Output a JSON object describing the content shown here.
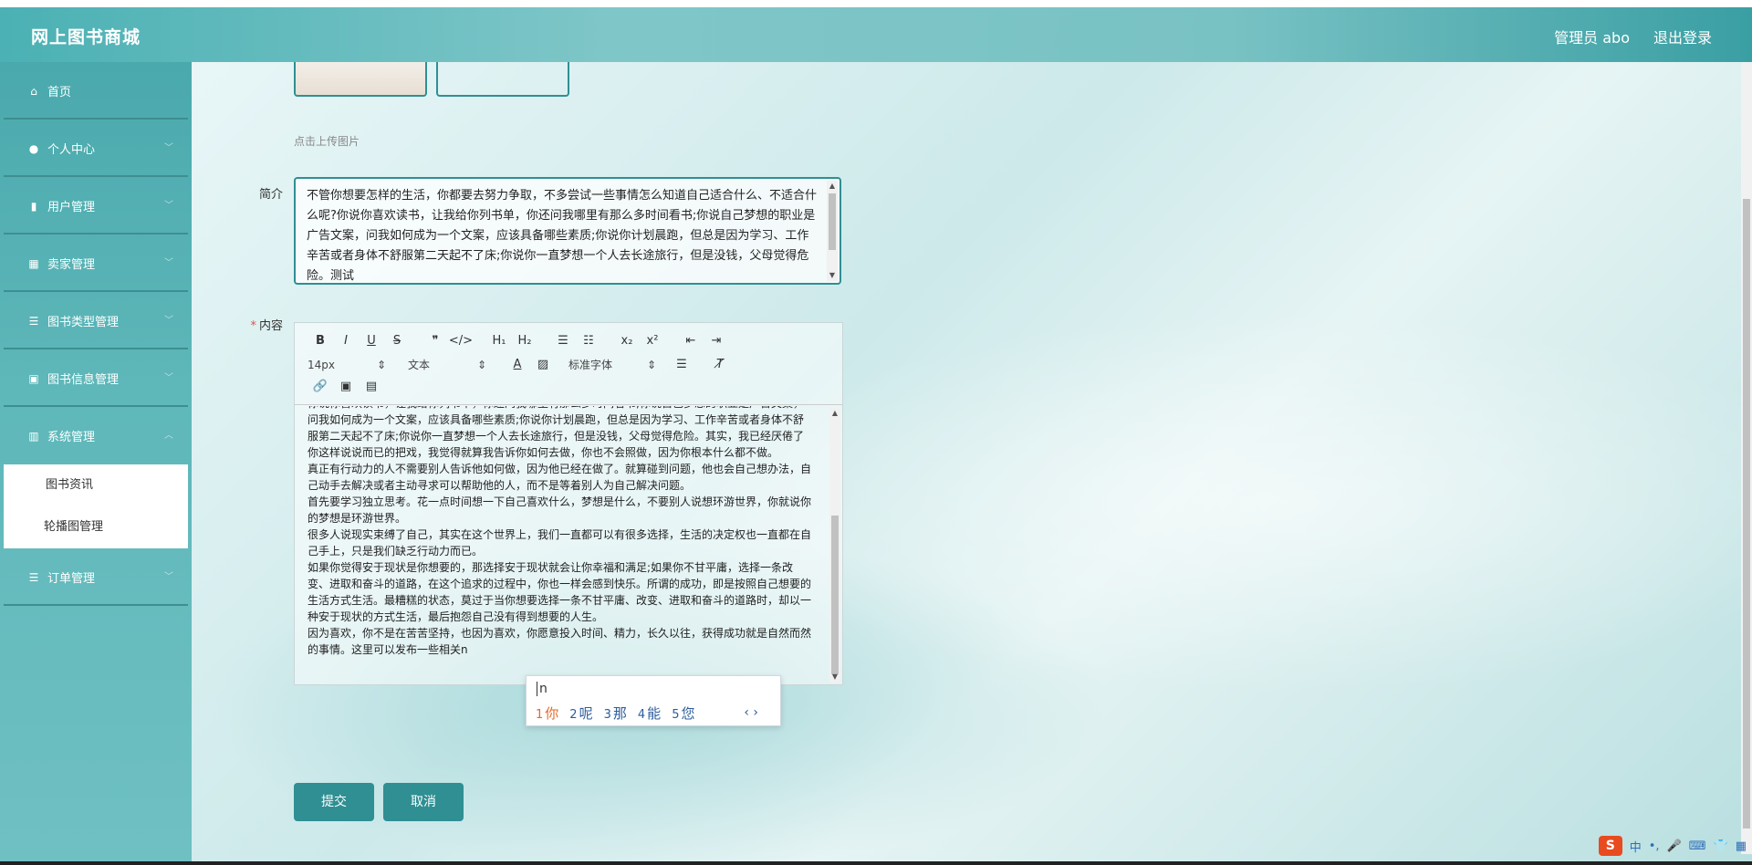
{
  "header": {
    "brand": "网上图书商城",
    "user": "管理员 abo",
    "logout": "退出登录"
  },
  "sidebar": {
    "items": [
      {
        "label": "首页",
        "icon": "home-icon",
        "chevron": false
      },
      {
        "label": "个人中心",
        "icon": "user-icon",
        "chevron": true
      },
      {
        "label": "用户管理",
        "icon": "users-icon",
        "chevron": true
      },
      {
        "label": "卖家管理",
        "icon": "grid-icon",
        "chevron": true
      },
      {
        "label": "图书类型管理",
        "icon": "sliders-icon",
        "chevron": true
      },
      {
        "label": "图书信息管理",
        "icon": "briefcase-icon",
        "chevron": true
      },
      {
        "label": "系统管理",
        "icon": "chart-icon",
        "chevron": true
      }
    ],
    "submenu": [
      "图书资讯",
      "轮播图管理"
    ],
    "last_item": {
      "label": "订单管理",
      "icon": "list-icon"
    }
  },
  "form": {
    "upload_tip": "点击上传图片",
    "intro_label": "简介",
    "intro_text": "不管你想要怎样的生活，你都要去努力争取，不多尝试一些事情怎么知道自己适合什么、不适合什么呢?你说你喜欢读书，让我给你列书单，你还问我哪里有那么多时间看书;你说自己梦想的职业是广告文案，问我如何成为一个文案，应该具备哪些素质;你说你计划晨跑，但总是因为学习、工作辛苦或者身体不舒服第二天起不了床;你说你一直梦想一个人去长途旅行，但是没钱，父母觉得危险。测试",
    "content_label": "内容",
    "required_mark": "*",
    "submit": "提交",
    "cancel": "取消"
  },
  "toolbar": {
    "row1": [
      "B",
      "I",
      "U",
      "S",
      "❞",
      "</>",
      "H₁",
      "H₂",
      "☰",
      "☷",
      "x₂",
      "x²",
      "⇤",
      "⇥"
    ],
    "font_size": "14px",
    "block": "文本",
    "font_family": "标准字体"
  },
  "editor": {
    "paragraphs": [
      "你说你喜欢读书，让我给你列书单，你还问我哪里有那么多时间看书;你说自己梦想的职业是广告文案，问我如何成为一个文案，应该具备哪些素质;你说你计划晨跑，但总是因为学习、工作辛苦或者身体不舒服第二天起不了床;你说你一直梦想一个人去长途旅行，但是没钱，父母觉得危险。其实，我已经厌倦了你这样说说而已的把戏，我觉得就算我告诉你如何去做，你也不会照做，因为你根本什么都不做。",
      "真正有行动力的人不需要别人告诉他如何做，因为他已经在做了。就算碰到问题，他也会自己想办法，自己动手去解决或者主动寻求可以帮助他的人，而不是等着别人为自己解决问题。",
      "首先要学习独立思考。花一点时间想一下自己喜欢什么，梦想是什么，不要别人说想环游世界，你就说你的梦想是环游世界。",
      "很多人说现实束缚了自己，其实在这个世界上，我们一直都可以有很多选择，生活的决定权也一直都在自己手上，只是我们缺乏行动力而已。",
      "如果你觉得安于现状是你想要的，那选择安于现状就会让你幸福和满足;如果你不甘平庸，选择一条改变、进取和奋斗的道路，在这个追求的过程中，你也一样会感到快乐。所谓的成功，即是按照自己想要的生活方式生活。最糟糕的状态，莫过于当你想要选择一条不甘平庸、改变、进取和奋斗的道路时，却以一种安于现状的方式生活，最后抱怨自己没有得到想要的人生。",
      "因为喜欢，你不是在苦苦坚持，也因为喜欢，你愿意投入时间、精力，长久以往，获得成功就是自然而然的事情。这里可以发布一些相关n"
    ]
  },
  "ime": {
    "pinyin": "n",
    "candidates": [
      {
        "n": "1",
        "w": "你"
      },
      {
        "n": "2",
        "w": "呢"
      },
      {
        "n": "3",
        "w": "那"
      },
      {
        "n": "4",
        "w": "能"
      },
      {
        "n": "5",
        "w": "您"
      }
    ],
    "nav": "‹ ›"
  },
  "tray": {
    "logo": "S",
    "items": [
      "中",
      "•,",
      "🎤",
      "⌨",
      "👕",
      "▦"
    ]
  }
}
